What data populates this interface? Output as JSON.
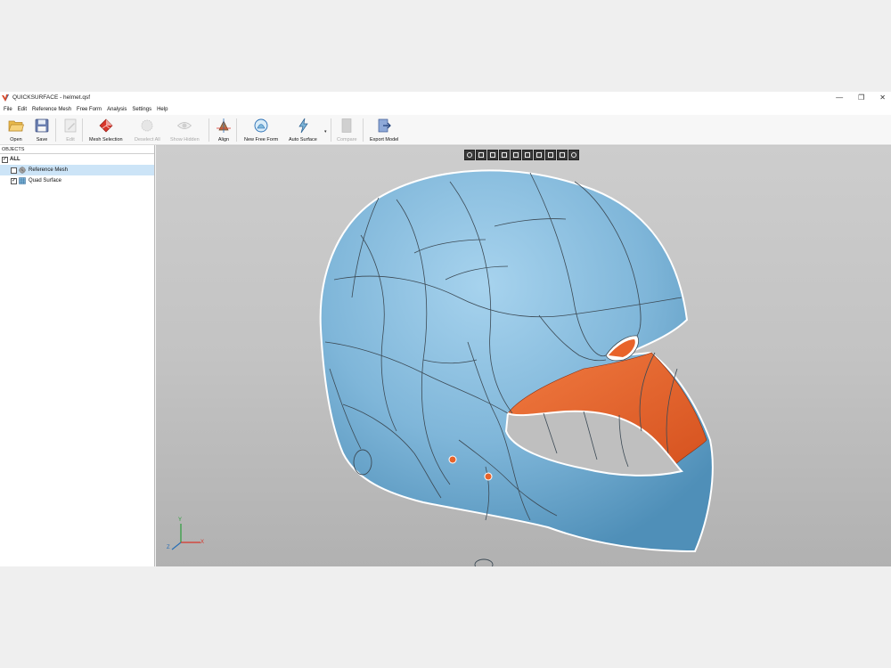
{
  "window": {
    "title": "QUICKSURFACE - helmet.qsf"
  },
  "window_controls": {
    "minimize": "—",
    "maximize": "❐",
    "close": "✕"
  },
  "menu": [
    "File",
    "Edit",
    "Reference Mesh",
    "Free Form",
    "Analysis",
    "Settings",
    "Help"
  ],
  "toolbar": {
    "open": "Open",
    "save": "Save",
    "edit": "Edit",
    "mesh_selection": "Mesh Selection",
    "deselect_all": "Deselect All",
    "show_hidden": "Show Hidden",
    "align": "Align",
    "new_free_form": "New Free Form",
    "auto_surface": "Auto Surface",
    "compare": "Compare",
    "export_model": "Export Model"
  },
  "objects_panel": {
    "header": "OBJECTS",
    "items": [
      {
        "label": "ALL",
        "checked": true
      },
      {
        "label": "Reference Mesh",
        "checked": false,
        "selected": true
      },
      {
        "label": "Quad Surface",
        "checked": true
      }
    ]
  },
  "axes": {
    "x": "X",
    "y": "Y",
    "z": "Z"
  },
  "colors": {
    "surface_blue": "#7fb6d9",
    "inner_orange": "#e8632a",
    "edge_dark": "#3c4a55",
    "viewport_bg": "#c8c8c8"
  },
  "icons": {
    "view_tools": [
      "zoom-fit-icon",
      "view-front-icon",
      "view-back-icon",
      "view-left-icon",
      "view-right-icon",
      "view-top-icon",
      "view-bottom-icon",
      "view-iso-icon",
      "view-section-icon",
      "view-axes-icon"
    ]
  }
}
